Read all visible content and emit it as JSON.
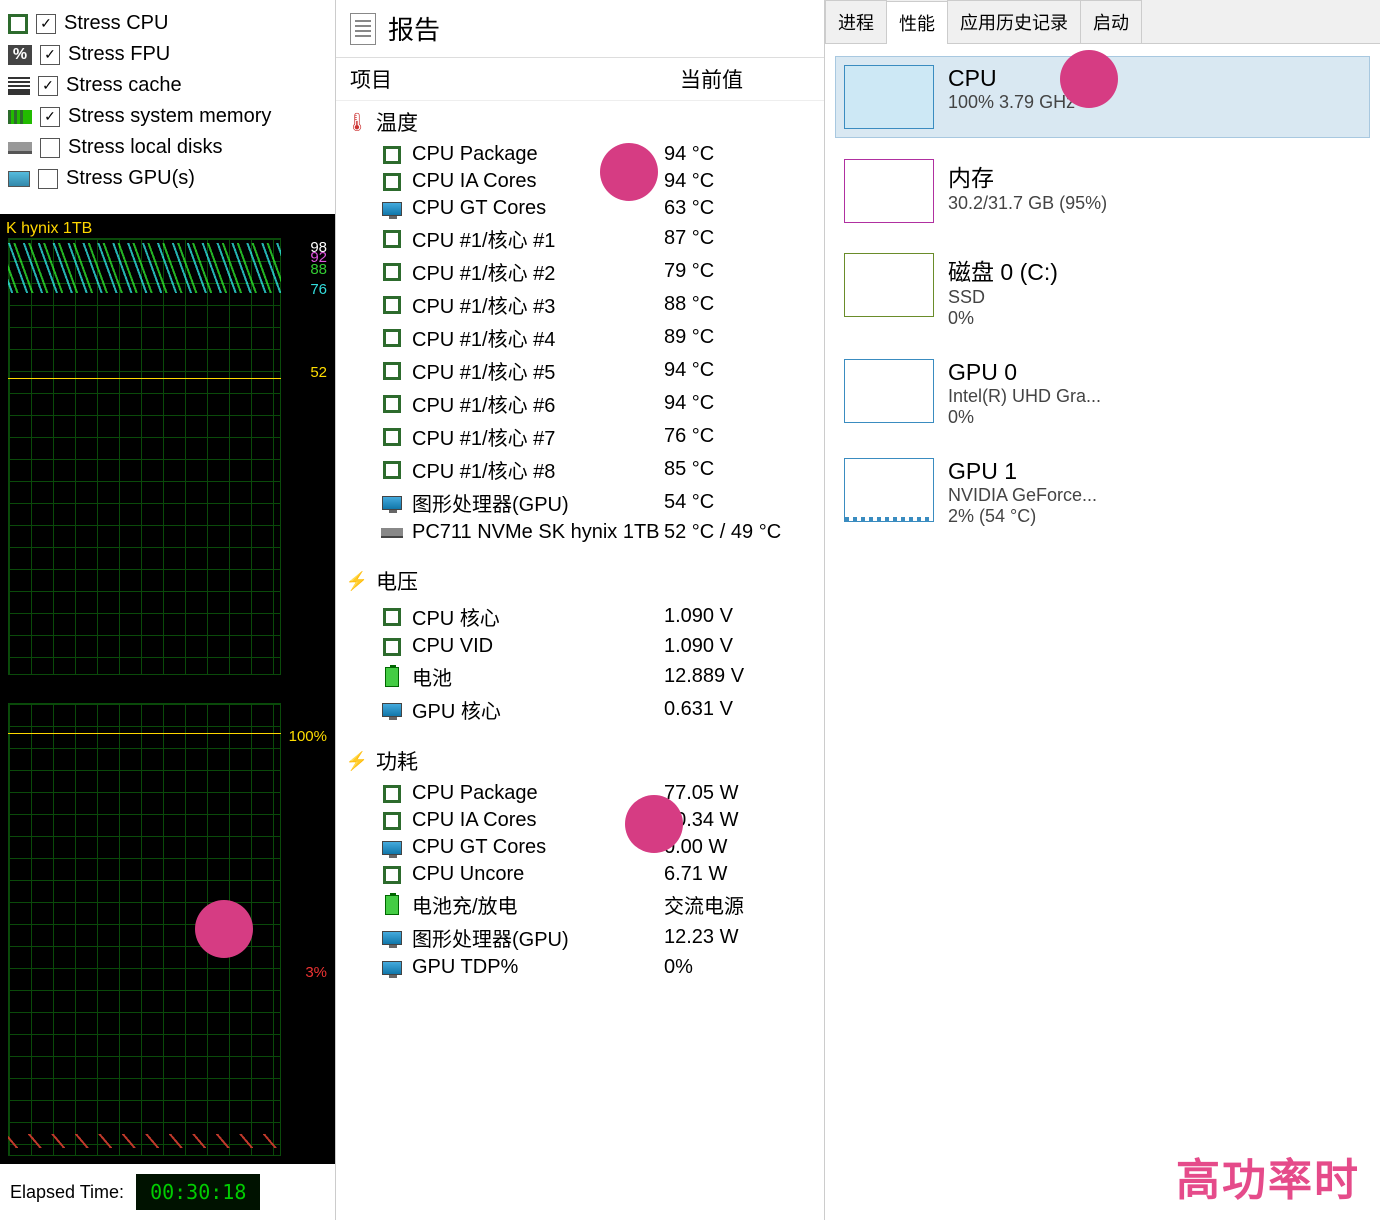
{
  "stress": {
    "items": [
      {
        "label": "Stress CPU",
        "checked": true,
        "icon": "cpu"
      },
      {
        "label": "Stress FPU",
        "checked": true,
        "icon": "fpu"
      },
      {
        "label": "Stress cache",
        "checked": true,
        "icon": "cache"
      },
      {
        "label": "Stress system memory",
        "checked": true,
        "icon": "mem"
      },
      {
        "label": "Stress local disks",
        "checked": false,
        "icon": "disk"
      },
      {
        "label": "Stress GPU(s)",
        "checked": false,
        "icon": "gpu"
      }
    ]
  },
  "graph1": {
    "title": "K hynix 1TB",
    "labels": [
      {
        "val": "98",
        "color": "#fff"
      },
      {
        "val": "92",
        "color": "#d5d"
      },
      {
        "val": "88",
        "color": "#3c3"
      },
      {
        "val": "76",
        "color": "#3dd"
      },
      {
        "val": "52",
        "color": "#fd0"
      }
    ]
  },
  "graph2": {
    "labels": [
      {
        "val": "100%",
        "color": "#fd0"
      },
      {
        "val": "3%",
        "color": "#e33"
      }
    ]
  },
  "elapsed": {
    "label": "Elapsed Time:",
    "value": "00:30:18"
  },
  "report": {
    "title": "报告",
    "col1": "项目",
    "col2": "当前值",
    "groups": [
      {
        "name": "温度",
        "icon": "therm",
        "rows": [
          {
            "ic": "sq",
            "name": "CPU Package",
            "val": "94 °C"
          },
          {
            "ic": "sq",
            "name": "CPU IA Cores",
            "val": "94 °C"
          },
          {
            "ic": "mon",
            "name": "CPU GT Cores",
            "val": "63 °C"
          },
          {
            "ic": "sq",
            "name": "CPU #1/核心 #1",
            "val": "87 °C"
          },
          {
            "ic": "sq",
            "name": "CPU #1/核心 #2",
            "val": "79 °C"
          },
          {
            "ic": "sq",
            "name": "CPU #1/核心 #3",
            "val": "88 °C"
          },
          {
            "ic": "sq",
            "name": "CPU #1/核心 #4",
            "val": "89 °C"
          },
          {
            "ic": "sq",
            "name": "CPU #1/核心 #5",
            "val": "94 °C"
          },
          {
            "ic": "sq",
            "name": "CPU #1/核心 #6",
            "val": "94 °C"
          },
          {
            "ic": "sq",
            "name": "CPU #1/核心 #7",
            "val": "76 °C"
          },
          {
            "ic": "sq",
            "name": "CPU #1/核心 #8",
            "val": "85 °C"
          },
          {
            "ic": "mon",
            "name": "图形处理器(GPU)",
            "val": "54 °C"
          },
          {
            "ic": "ssd",
            "name": "PC711 NVMe SK hynix 1TB",
            "val": "52 °C / 49 °C"
          }
        ]
      },
      {
        "name": "电压",
        "icon": "bolt",
        "rows": [
          {
            "ic": "sq",
            "name": "CPU 核心",
            "val": "1.090 V"
          },
          {
            "ic": "sq",
            "name": "CPU VID",
            "val": "1.090 V"
          },
          {
            "ic": "bat",
            "name": "电池",
            "val": "12.889 V"
          },
          {
            "ic": "mon",
            "name": "GPU 核心",
            "val": "0.631 V"
          }
        ]
      },
      {
        "name": "功耗",
        "icon": "bolt",
        "rows": [
          {
            "ic": "sq",
            "name": "CPU Package",
            "val": "77.05 W"
          },
          {
            "ic": "sq",
            "name": "CPU IA Cores",
            "val": "70.34 W"
          },
          {
            "ic": "mon",
            "name": "CPU GT Cores",
            "val": "0.00 W"
          },
          {
            "ic": "sq",
            "name": "CPU Uncore",
            "val": "6.71 W"
          },
          {
            "ic": "bat",
            "name": "电池充/放电",
            "val": "交流电源"
          },
          {
            "ic": "mon",
            "name": "图形处理器(GPU)",
            "val": "12.23 W"
          },
          {
            "ic": "mon",
            "name": "GPU TDP%",
            "val": "0%"
          }
        ]
      }
    ]
  },
  "tm": {
    "tabs": [
      "进程",
      "性能",
      "应用历史记录",
      "启动"
    ],
    "active_tab": 1,
    "items": [
      {
        "name": "CPU",
        "stat": "100% 3.79 GHz",
        "thumb": "cpu",
        "sel": true
      },
      {
        "name": "内存",
        "stat": "30.2/31.7 GB (95%)",
        "thumb": "mem"
      },
      {
        "name": "磁盘 0 (C:)",
        "stat": "SSD",
        "stat2": "0%",
        "thumb": "disk"
      },
      {
        "name": "GPU 0",
        "stat": "Intel(R) UHD Gra...",
        "stat2": "0%",
        "thumb": "gpu0"
      },
      {
        "name": "GPU 1",
        "stat": "NVIDIA GeForce...",
        "stat2": "2% (54 °C)",
        "thumb": "gpu1"
      }
    ]
  },
  "watermark": "高功率时"
}
